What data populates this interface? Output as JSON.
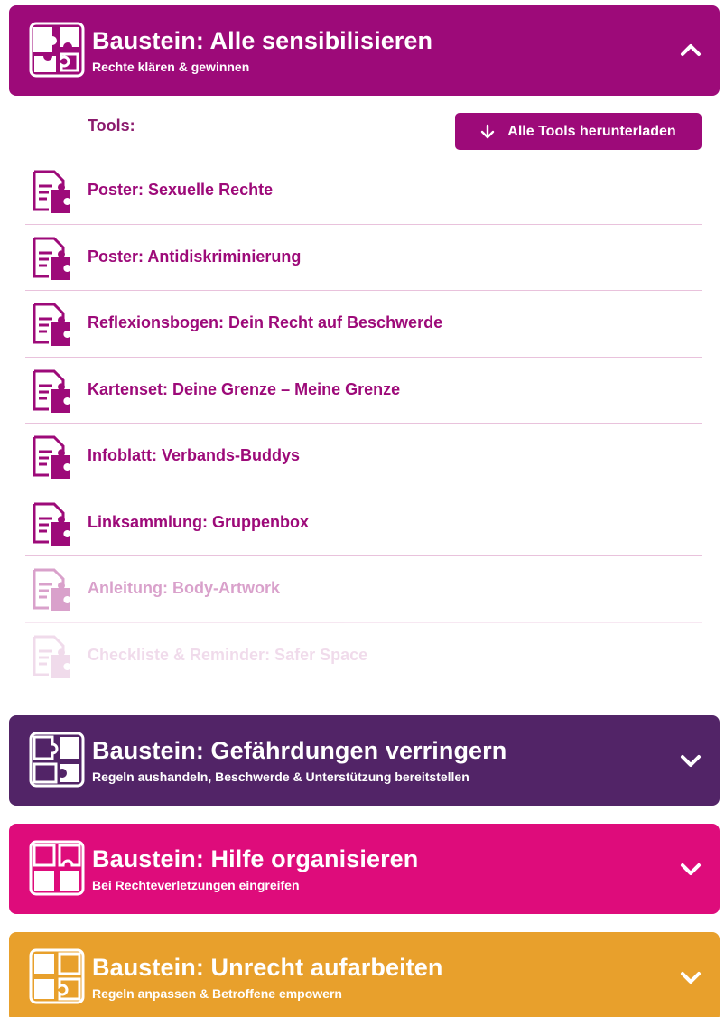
{
  "colors": {
    "magenta_dark": "#9d0a79",
    "purple": "#522467",
    "pink": "#de0c7b",
    "orange": "#e8a02c"
  },
  "modules": [
    {
      "title": "Baustein: Alle sensibilisieren",
      "subtitle": "Rechte klären & gewinnen",
      "expanded": true,
      "icon": "puzzle-icon"
    },
    {
      "title": "Baustein: Gefährdungen verringern",
      "subtitle": "Regeln aushandeln, Beschwerde & Unterstützung bereitstellen",
      "expanded": false,
      "icon": "puzzle-icon"
    },
    {
      "title": "Baustein: Hilfe organisieren",
      "subtitle": "Bei Rechteverletzungen eingreifen",
      "expanded": false,
      "icon": "puzzle-icon"
    },
    {
      "title": "Baustein: Unrecht aufarbeiten",
      "subtitle": "Regeln anpassen & Betroffene empowern",
      "expanded": false,
      "icon": "puzzle-icon"
    }
  ],
  "tools": {
    "label": "Tools:",
    "download_all_label": "Alle Tools herunterladen",
    "items": [
      {
        "label": "Poster: Sexuelle Rechte"
      },
      {
        "label": "Poster: Antidiskriminierung"
      },
      {
        "label": "Reflexionsbogen: Dein Recht auf Beschwerde"
      },
      {
        "label": "Kartenset: Deine Grenze – Meine Grenze"
      },
      {
        "label": "Infoblatt: Verbands-Buddys"
      },
      {
        "label": "Linksammlung: Gruppenbox"
      },
      {
        "label": "Anleitung: Body-Artwork"
      },
      {
        "label": "Checkliste & Reminder: Safer Space"
      }
    ]
  }
}
